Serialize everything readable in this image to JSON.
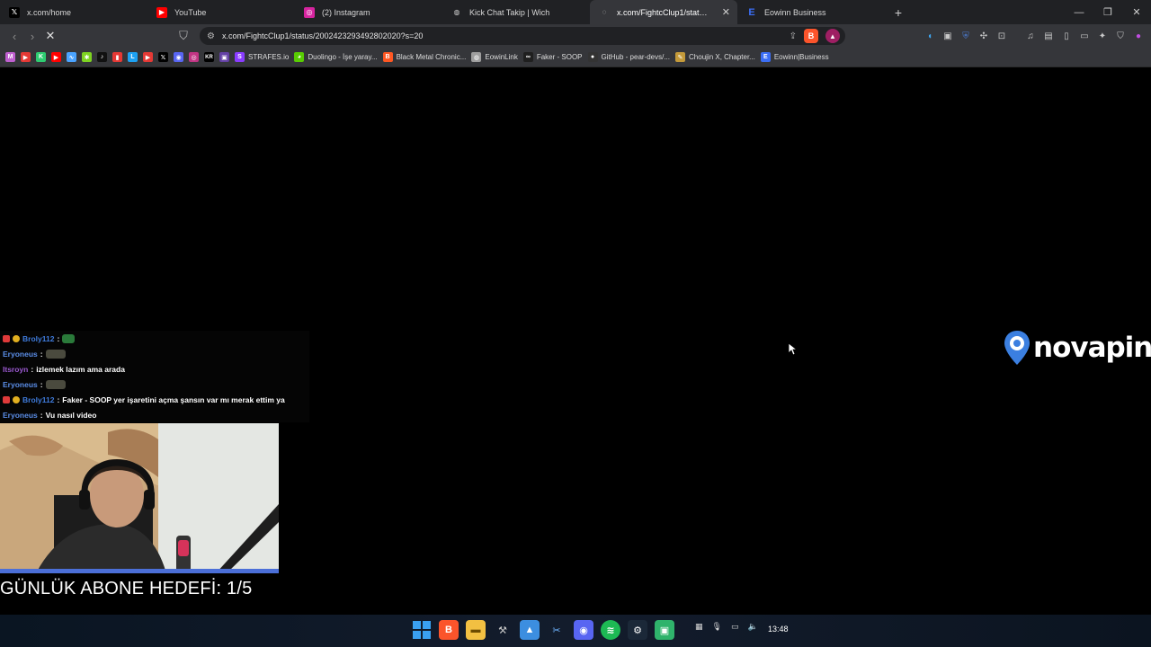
{
  "tabs": [
    {
      "title": "x.com/home",
      "icon": "x-logo-icon",
      "color": "#000000"
    },
    {
      "title": "YouTube",
      "icon": "youtube-icon",
      "color": "#ff0000"
    },
    {
      "title": "(2) Instagram",
      "icon": "instagram-icon",
      "color": "#d6249f"
    },
    {
      "title": "Kick Chat Takip | Wich",
      "icon": "globe-icon",
      "color": "#5f6368"
    },
    {
      "title": "x.com/FightcClup1/status/2002…",
      "icon": "loading-icon",
      "color": "#5f6368",
      "active": true
    },
    {
      "title": "Eowinn Business",
      "icon": "eowinn-icon",
      "color": "#3b6ef5"
    }
  ],
  "address": {
    "url": "x.com/FightcClup1/status/2002423293492802020?s=20"
  },
  "bookmarks": [
    {
      "label": "STRAFES.io",
      "color": "#8a3cff"
    },
    {
      "label": "Duolingo - İşe yaray...",
      "color": "#58cc02"
    },
    {
      "label": "Black Metal Chronic...",
      "color": "#ff5722"
    },
    {
      "label": "EowinLink",
      "color": "#9e9e9e"
    },
    {
      "label": "Faker - SOOP",
      "color": "#1f1f1f"
    },
    {
      "label": "GitHub - pear-devs/...",
      "color": "#333333"
    },
    {
      "label": "Choujin X, Chapter...",
      "color": "#c49a3a"
    },
    {
      "label": "Eowinn|Business",
      "color": "#3b6ef5"
    }
  ],
  "bookmark_icons": [
    "#c060d0",
    "#e53935",
    "#2ecc71",
    "#ff0000",
    "#4aa3ff",
    "#7ed321",
    "#000000",
    "#e53935",
    "#1da1f2",
    "#e53935",
    "#000000",
    "#5865f2",
    "#c13584",
    "#000000",
    "#6441a5"
  ],
  "chat": {
    "messages": [
      {
        "user": "Broly112",
        "user_color": "#3f7bdc",
        "text": "",
        "badges": true,
        "emote": "#2a7a3a"
      },
      {
        "user": "Eryoneus",
        "user_color": "#5b8ee8",
        "text": "",
        "badges": false,
        "emote": "#4a4a3e"
      },
      {
        "user": "Itsroyn",
        "user_color": "#9b59d0",
        "text": "izlemek lazım ama arada",
        "badges": false,
        "emote": null
      },
      {
        "user": "Eryoneus",
        "user_color": "#5b8ee8",
        "text": "",
        "badges": false,
        "emote": "#4a4a3e"
      },
      {
        "user": "Broly112",
        "user_color": "#3f7bdc",
        "text": "Faker - SOOP yer işaretini açma şansın var mı merak ettim ya",
        "badges": true,
        "emote": null
      },
      {
        "user": "Eryoneus",
        "user_color": "#5b8ee8",
        "text": "Vu nasıl video",
        "badges": false,
        "emote": null
      }
    ]
  },
  "overlay": {
    "goal_text": "GÜNLÜK ABONE HEDEFİ: 1/5",
    "logo_text": "novapin"
  },
  "taskbar": {
    "time": "13:48"
  }
}
